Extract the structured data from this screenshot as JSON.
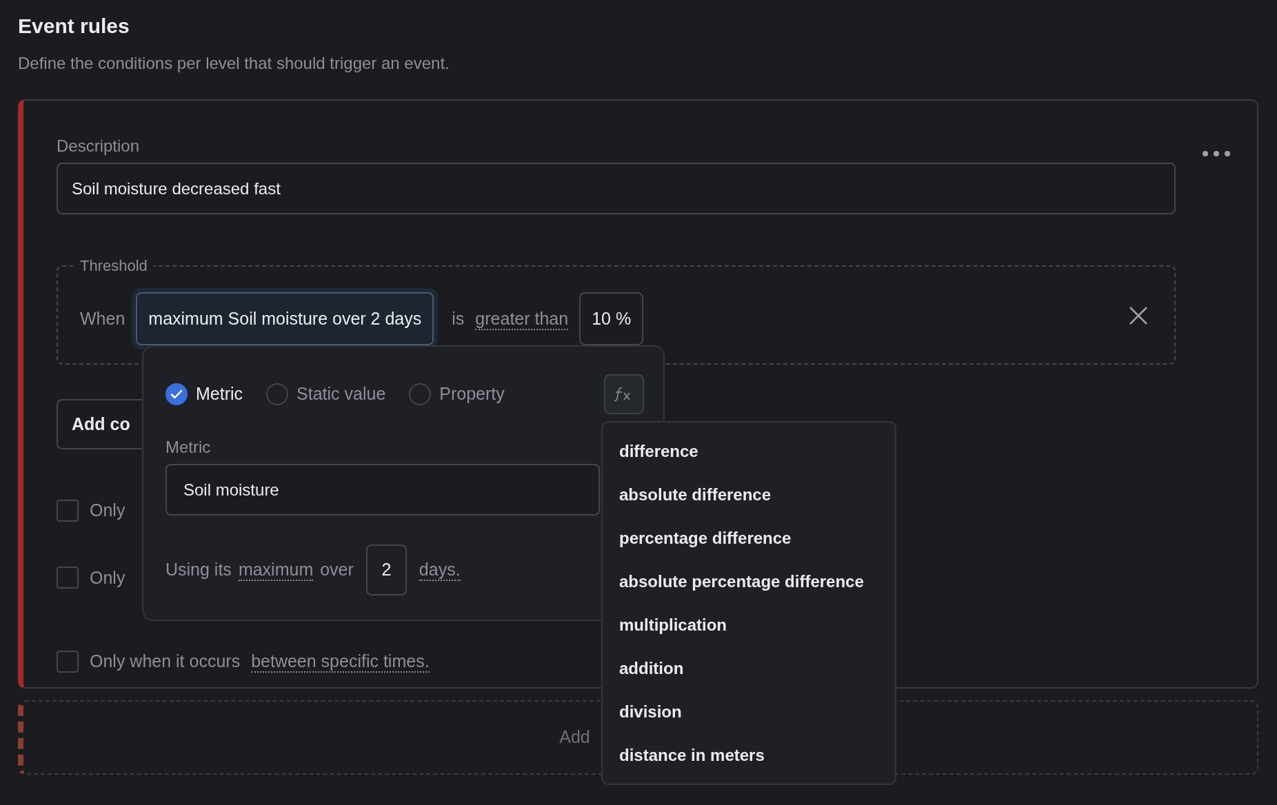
{
  "header": {
    "title": "Event rules",
    "subtitle": "Define the conditions per level that should trigger an event."
  },
  "description": {
    "label": "Description",
    "value": "Soil moisture decreased fast"
  },
  "threshold": {
    "legend": "Threshold",
    "prefix": "When",
    "operand": "maximum Soil moisture over 2 days",
    "operand_active": true,
    "comparator_prefix": "is",
    "comparator": "greater than",
    "value": "10 %"
  },
  "add_condition_button": "Add co",
  "options": [
    {
      "text": "Only",
      "checked": false
    },
    {
      "text": "Only",
      "checked": false
    },
    {
      "text": "Only when it occurs",
      "link": "between specific times.",
      "checked": false
    }
  ],
  "popover": {
    "sources": [
      {
        "label": "Metric",
        "selected": true
      },
      {
        "label": "Static value",
        "selected": false
      },
      {
        "label": "Property",
        "selected": false
      }
    ],
    "metric_label": "Metric",
    "metric_value": "Soil moisture",
    "using_prefix": "Using its",
    "aggregation": "maximum",
    "over": "over",
    "period_value": "2",
    "period_unit": "days."
  },
  "functions_menu": {
    "items": [
      "difference",
      "absolute difference",
      "percentage difference",
      "absolute percentage difference",
      "multiplication",
      "addition",
      "division",
      "distance in meters"
    ]
  },
  "add_rule": {
    "label": "Add"
  }
}
